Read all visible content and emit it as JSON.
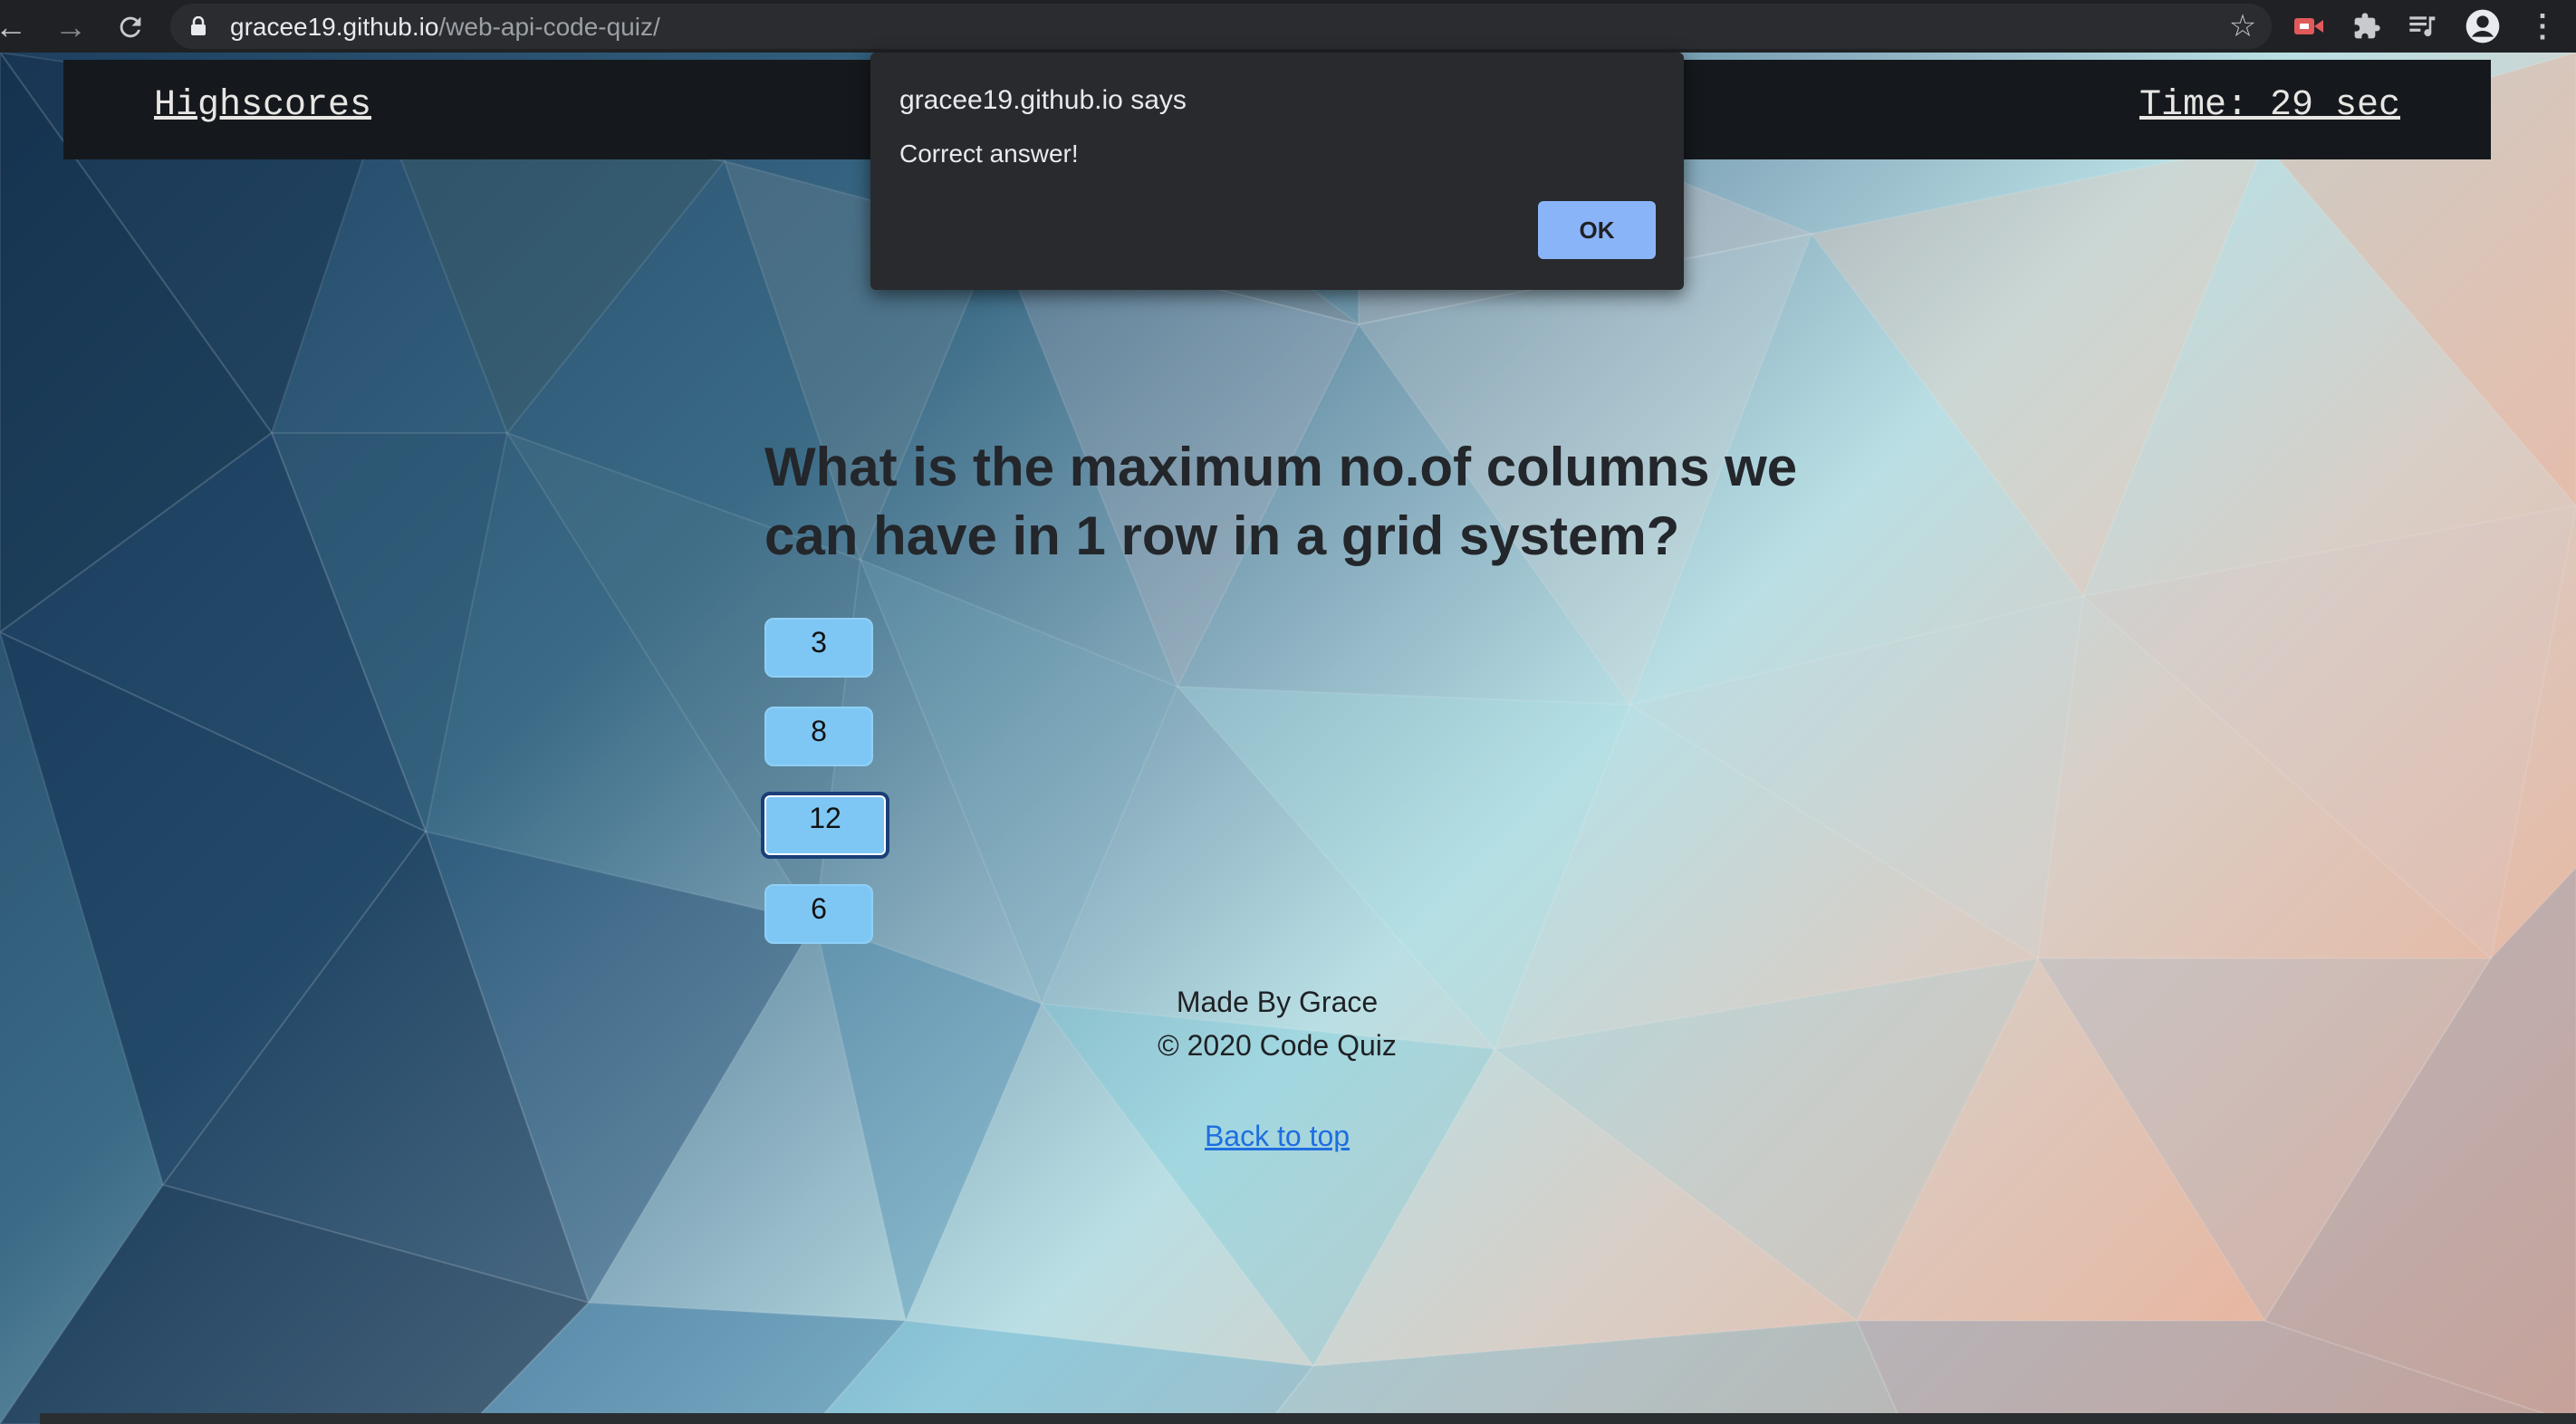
{
  "browser": {
    "url_host": "gracee19.github.io",
    "url_path": "/web-api-code-quiz/"
  },
  "header": {
    "highscores_label": "Highscores",
    "timer_text": "Time: 29 sec"
  },
  "quiz": {
    "question": "What is the maximum no.of columns we can have in 1 row in a grid system?",
    "answers": [
      "3",
      "8",
      "12",
      "6"
    ]
  },
  "footer": {
    "made_by": "Made By Grace",
    "copyright": "© 2020 Code Quiz",
    "back_to_top": "Back to top"
  },
  "dialog": {
    "title": "gracee19.github.io says",
    "message": "Correct answer!",
    "ok_label": "OK"
  },
  "colors": {
    "chrome": "#202124",
    "header_bar": "#15191d",
    "answer_button": "#7ec7f5",
    "dialog_ok": "#8ab4f8",
    "link": "#1f6ee0"
  }
}
